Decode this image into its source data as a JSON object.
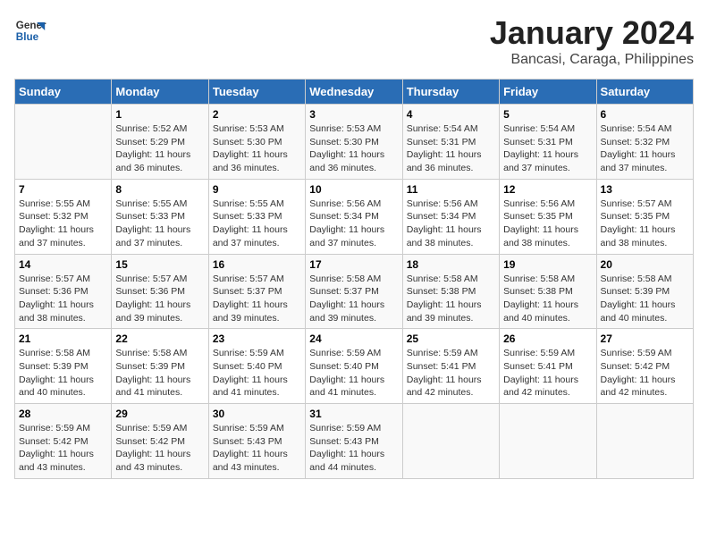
{
  "header": {
    "logo_line1": "General",
    "logo_line2": "Blue",
    "title": "January 2024",
    "subtitle": "Bancasi, Caraga, Philippines"
  },
  "days_of_week": [
    "Sunday",
    "Monday",
    "Tuesday",
    "Wednesday",
    "Thursday",
    "Friday",
    "Saturday"
  ],
  "weeks": [
    [
      {
        "day": "",
        "info": ""
      },
      {
        "day": "1",
        "info": "Sunrise: 5:52 AM\nSunset: 5:29 PM\nDaylight: 11 hours\nand 36 minutes."
      },
      {
        "day": "2",
        "info": "Sunrise: 5:53 AM\nSunset: 5:30 PM\nDaylight: 11 hours\nand 36 minutes."
      },
      {
        "day": "3",
        "info": "Sunrise: 5:53 AM\nSunset: 5:30 PM\nDaylight: 11 hours\nand 36 minutes."
      },
      {
        "day": "4",
        "info": "Sunrise: 5:54 AM\nSunset: 5:31 PM\nDaylight: 11 hours\nand 36 minutes."
      },
      {
        "day": "5",
        "info": "Sunrise: 5:54 AM\nSunset: 5:31 PM\nDaylight: 11 hours\nand 37 minutes."
      },
      {
        "day": "6",
        "info": "Sunrise: 5:54 AM\nSunset: 5:32 PM\nDaylight: 11 hours\nand 37 minutes."
      }
    ],
    [
      {
        "day": "7",
        "info": "Sunrise: 5:55 AM\nSunset: 5:32 PM\nDaylight: 11 hours\nand 37 minutes."
      },
      {
        "day": "8",
        "info": "Sunrise: 5:55 AM\nSunset: 5:33 PM\nDaylight: 11 hours\nand 37 minutes."
      },
      {
        "day": "9",
        "info": "Sunrise: 5:55 AM\nSunset: 5:33 PM\nDaylight: 11 hours\nand 37 minutes."
      },
      {
        "day": "10",
        "info": "Sunrise: 5:56 AM\nSunset: 5:34 PM\nDaylight: 11 hours\nand 37 minutes."
      },
      {
        "day": "11",
        "info": "Sunrise: 5:56 AM\nSunset: 5:34 PM\nDaylight: 11 hours\nand 38 minutes."
      },
      {
        "day": "12",
        "info": "Sunrise: 5:56 AM\nSunset: 5:35 PM\nDaylight: 11 hours\nand 38 minutes."
      },
      {
        "day": "13",
        "info": "Sunrise: 5:57 AM\nSunset: 5:35 PM\nDaylight: 11 hours\nand 38 minutes."
      }
    ],
    [
      {
        "day": "14",
        "info": "Sunrise: 5:57 AM\nSunset: 5:36 PM\nDaylight: 11 hours\nand 38 minutes."
      },
      {
        "day": "15",
        "info": "Sunrise: 5:57 AM\nSunset: 5:36 PM\nDaylight: 11 hours\nand 39 minutes."
      },
      {
        "day": "16",
        "info": "Sunrise: 5:57 AM\nSunset: 5:37 PM\nDaylight: 11 hours\nand 39 minutes."
      },
      {
        "day": "17",
        "info": "Sunrise: 5:58 AM\nSunset: 5:37 PM\nDaylight: 11 hours\nand 39 minutes."
      },
      {
        "day": "18",
        "info": "Sunrise: 5:58 AM\nSunset: 5:38 PM\nDaylight: 11 hours\nand 39 minutes."
      },
      {
        "day": "19",
        "info": "Sunrise: 5:58 AM\nSunset: 5:38 PM\nDaylight: 11 hours\nand 40 minutes."
      },
      {
        "day": "20",
        "info": "Sunrise: 5:58 AM\nSunset: 5:39 PM\nDaylight: 11 hours\nand 40 minutes."
      }
    ],
    [
      {
        "day": "21",
        "info": "Sunrise: 5:58 AM\nSunset: 5:39 PM\nDaylight: 11 hours\nand 40 minutes."
      },
      {
        "day": "22",
        "info": "Sunrise: 5:58 AM\nSunset: 5:39 PM\nDaylight: 11 hours\nand 41 minutes."
      },
      {
        "day": "23",
        "info": "Sunrise: 5:59 AM\nSunset: 5:40 PM\nDaylight: 11 hours\nand 41 minutes."
      },
      {
        "day": "24",
        "info": "Sunrise: 5:59 AM\nSunset: 5:40 PM\nDaylight: 11 hours\nand 41 minutes."
      },
      {
        "day": "25",
        "info": "Sunrise: 5:59 AM\nSunset: 5:41 PM\nDaylight: 11 hours\nand 42 minutes."
      },
      {
        "day": "26",
        "info": "Sunrise: 5:59 AM\nSunset: 5:41 PM\nDaylight: 11 hours\nand 42 minutes."
      },
      {
        "day": "27",
        "info": "Sunrise: 5:59 AM\nSunset: 5:42 PM\nDaylight: 11 hours\nand 42 minutes."
      }
    ],
    [
      {
        "day": "28",
        "info": "Sunrise: 5:59 AM\nSunset: 5:42 PM\nDaylight: 11 hours\nand 43 minutes."
      },
      {
        "day": "29",
        "info": "Sunrise: 5:59 AM\nSunset: 5:42 PM\nDaylight: 11 hours\nand 43 minutes."
      },
      {
        "day": "30",
        "info": "Sunrise: 5:59 AM\nSunset: 5:43 PM\nDaylight: 11 hours\nand 43 minutes."
      },
      {
        "day": "31",
        "info": "Sunrise: 5:59 AM\nSunset: 5:43 PM\nDaylight: 11 hours\nand 44 minutes."
      },
      {
        "day": "",
        "info": ""
      },
      {
        "day": "",
        "info": ""
      },
      {
        "day": "",
        "info": ""
      }
    ]
  ]
}
